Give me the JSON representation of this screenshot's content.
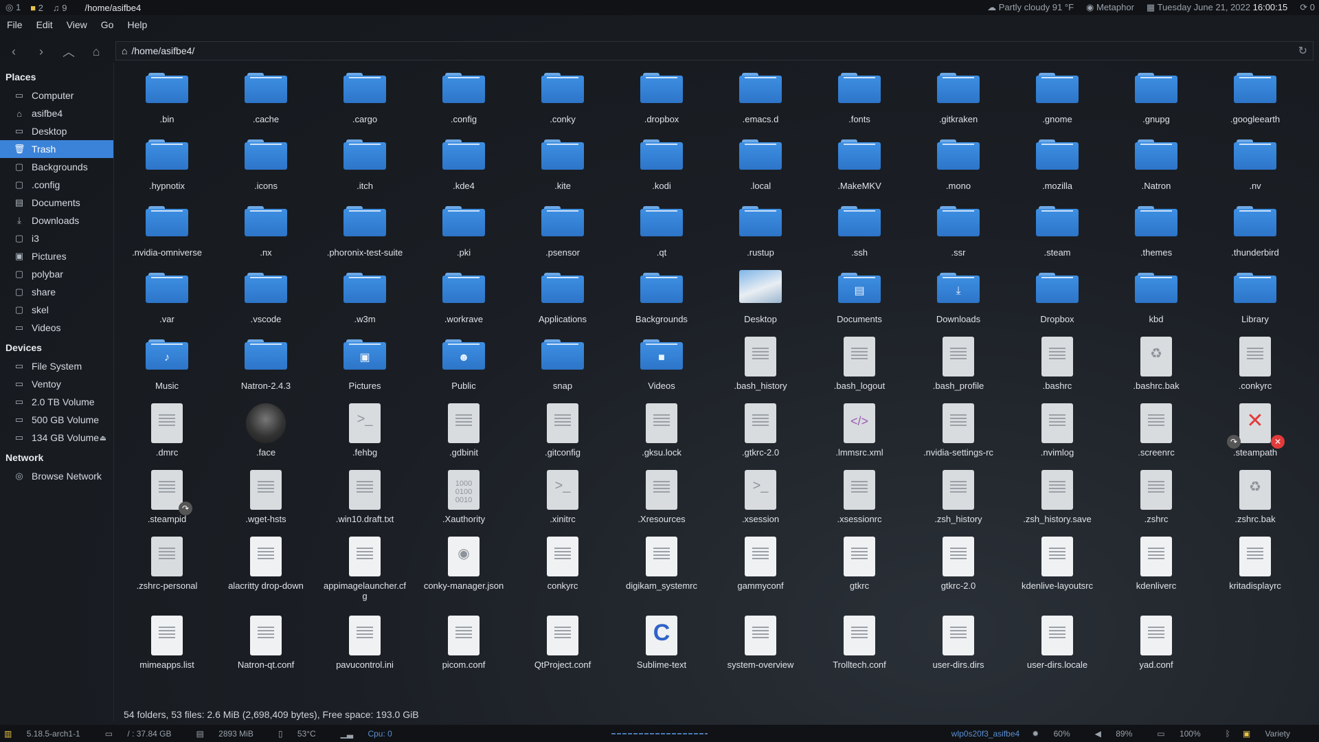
{
  "topbar": {
    "workspaces": [
      "1",
      "2",
      "9"
    ],
    "window_title": "/home/asifbe4",
    "weather": "Partly cloudy 91 °F",
    "theme": "Metaphor",
    "date": "Tuesday  June 21, 2022",
    "time": "16:00:15",
    "updates": "0"
  },
  "menu": [
    "File",
    "Edit",
    "View",
    "Go",
    "Help"
  ],
  "address": "/home/asifbe4/",
  "sidebar": {
    "places_title": "Places",
    "places": [
      {
        "label": "Computer",
        "icon": "computer-icon"
      },
      {
        "label": "asifbe4",
        "icon": "home-icon"
      },
      {
        "label": "Desktop",
        "icon": "desktop-icon"
      },
      {
        "label": "Trash",
        "icon": "trash-icon",
        "active": true
      },
      {
        "label": "Backgrounds",
        "icon": "folder-icon"
      },
      {
        "label": ".config",
        "icon": "folder-icon"
      },
      {
        "label": "Documents",
        "icon": "documents-icon"
      },
      {
        "label": "Downloads",
        "icon": "download-icon"
      },
      {
        "label": "i3",
        "icon": "folder-icon"
      },
      {
        "label": "Pictures",
        "icon": "pictures-icon"
      },
      {
        "label": "polybar",
        "icon": "folder-icon"
      },
      {
        "label": "share",
        "icon": "folder-icon"
      },
      {
        "label": "skel",
        "icon": "folder-icon"
      },
      {
        "label": "Videos",
        "icon": "videos-icon"
      }
    ],
    "devices_title": "Devices",
    "devices": [
      {
        "label": "File System",
        "icon": "drive-icon"
      },
      {
        "label": "Ventoy",
        "icon": "drive-icon"
      },
      {
        "label": "2.0 TB Volume",
        "icon": "drive-icon"
      },
      {
        "label": "500 GB Volume",
        "icon": "drive-icon"
      },
      {
        "label": "134 GB Volume",
        "icon": "drive-icon",
        "eject": true
      }
    ],
    "network_title": "Network",
    "network": [
      {
        "label": "Browse Network",
        "icon": "network-icon"
      }
    ]
  },
  "files": [
    {
      "name": ".bin",
      "kind": "folder"
    },
    {
      "name": ".cache",
      "kind": "folder"
    },
    {
      "name": ".cargo",
      "kind": "folder"
    },
    {
      "name": ".config",
      "kind": "folder"
    },
    {
      "name": ".conky",
      "kind": "folder"
    },
    {
      "name": ".dropbox",
      "kind": "folder"
    },
    {
      "name": ".emacs.d",
      "kind": "folder"
    },
    {
      "name": ".fonts",
      "kind": "folder"
    },
    {
      "name": ".gitkraken",
      "kind": "folder"
    },
    {
      "name": ".gnome",
      "kind": "folder"
    },
    {
      "name": ".gnupg",
      "kind": "folder"
    },
    {
      "name": ".googleearth",
      "kind": "folder"
    },
    {
      "name": ".hypnotix",
      "kind": "folder"
    },
    {
      "name": ".icons",
      "kind": "folder"
    },
    {
      "name": ".itch",
      "kind": "folder"
    },
    {
      "name": ".kde4",
      "kind": "folder"
    },
    {
      "name": ".kite",
      "kind": "folder"
    },
    {
      "name": ".kodi",
      "kind": "folder"
    },
    {
      "name": ".local",
      "kind": "folder"
    },
    {
      "name": ".MakeMKV",
      "kind": "folder"
    },
    {
      "name": ".mono",
      "kind": "folder"
    },
    {
      "name": ".mozilla",
      "kind": "folder"
    },
    {
      "name": ".Natron",
      "kind": "folder"
    },
    {
      "name": ".nv",
      "kind": "folder"
    },
    {
      "name": ".nvidia-omniverse",
      "kind": "folder"
    },
    {
      "name": ".nx",
      "kind": "folder"
    },
    {
      "name": ".phoronix-test-suite",
      "kind": "folder"
    },
    {
      "name": ".pki",
      "kind": "folder"
    },
    {
      "name": ".psensor",
      "kind": "folder"
    },
    {
      "name": ".qt",
      "kind": "folder"
    },
    {
      "name": ".rustup",
      "kind": "folder"
    },
    {
      "name": ".ssh",
      "kind": "folder"
    },
    {
      "name": ".ssr",
      "kind": "folder"
    },
    {
      "name": ".steam",
      "kind": "folder"
    },
    {
      "name": ".themes",
      "kind": "folder"
    },
    {
      "name": ".thunderbird",
      "kind": "folder"
    },
    {
      "name": ".var",
      "kind": "folder"
    },
    {
      "name": ".vscode",
      "kind": "folder"
    },
    {
      "name": ".w3m",
      "kind": "folder"
    },
    {
      "name": ".workrave",
      "kind": "folder"
    },
    {
      "name": "Applications",
      "kind": "folder"
    },
    {
      "name": "Backgrounds",
      "kind": "folder"
    },
    {
      "name": "Desktop",
      "kind": "desktop"
    },
    {
      "name": "Documents",
      "kind": "folder",
      "emblem": "document-emblem-icon"
    },
    {
      "name": "Downloads",
      "kind": "folder",
      "emblem": "download-emblem-icon"
    },
    {
      "name": "Dropbox",
      "kind": "folder"
    },
    {
      "name": "kbd",
      "kind": "folder"
    },
    {
      "name": "Library",
      "kind": "folder"
    },
    {
      "name": "Music",
      "kind": "folder",
      "emblem": "music-emblem-icon"
    },
    {
      "name": "Natron-2.4.3",
      "kind": "folder"
    },
    {
      "name": "Pictures",
      "kind": "folder",
      "emblem": "picture-emblem-icon"
    },
    {
      "name": "Public",
      "kind": "folder",
      "emblem": "people-emblem-icon"
    },
    {
      "name": "snap",
      "kind": "folder"
    },
    {
      "name": "Videos",
      "kind": "folder",
      "emblem": "video-emblem-icon"
    },
    {
      "name": ".bash_history",
      "kind": "text"
    },
    {
      "name": ".bash_logout",
      "kind": "text"
    },
    {
      "name": ".bash_profile",
      "kind": "text"
    },
    {
      "name": ".bashrc",
      "kind": "text"
    },
    {
      "name": ".bashrc.bak",
      "kind": "backup"
    },
    {
      "name": ".conkyrc",
      "kind": "text"
    },
    {
      "name": ".dmrc",
      "kind": "text"
    },
    {
      "name": ".face",
      "kind": "image"
    },
    {
      "name": ".fehbg",
      "kind": "script"
    },
    {
      "name": ".gdbinit",
      "kind": "text"
    },
    {
      "name": ".gitconfig",
      "kind": "text"
    },
    {
      "name": ".gksu.lock",
      "kind": "text"
    },
    {
      "name": ".gtkrc-2.0",
      "kind": "text"
    },
    {
      "name": ".lmmsrc.xml",
      "kind": "xml"
    },
    {
      "name": ".nvidia-settings-rc",
      "kind": "text"
    },
    {
      "name": ".nvimlog",
      "kind": "text"
    },
    {
      "name": ".screenrc",
      "kind": "text"
    },
    {
      "name": ".steampath",
      "kind": "broken"
    },
    {
      "name": ".steampid",
      "kind": "text",
      "link": true
    },
    {
      "name": ".wget-hsts",
      "kind": "text"
    },
    {
      "name": ".win10.draft.txt",
      "kind": "text"
    },
    {
      "name": ".Xauthority",
      "kind": "binary"
    },
    {
      "name": ".xinitrc",
      "kind": "script"
    },
    {
      "name": ".Xresources",
      "kind": "text"
    },
    {
      "name": ".xsession",
      "kind": "script"
    },
    {
      "name": ".xsessionrc",
      "kind": "text"
    },
    {
      "name": ".zsh_history",
      "kind": "text"
    },
    {
      "name": ".zsh_history.save",
      "kind": "text"
    },
    {
      "name": ".zshrc",
      "kind": "text"
    },
    {
      "name": ".zshrc.bak",
      "kind": "backup"
    },
    {
      "name": ".zshrc-personal",
      "kind": "text"
    },
    {
      "name": "alacritty drop-down",
      "kind": "light"
    },
    {
      "name": "appimagelauncher.cfg",
      "kind": "light"
    },
    {
      "name": "conky-manager.json",
      "kind": "json"
    },
    {
      "name": "conkyrc",
      "kind": "light"
    },
    {
      "name": "digikam_systemrc",
      "kind": "light"
    },
    {
      "name": "gammyconf",
      "kind": "light"
    },
    {
      "name": "gtkrc",
      "kind": "light"
    },
    {
      "name": "gtkrc-2.0",
      "kind": "light"
    },
    {
      "name": "kdenlive-layoutsrc",
      "kind": "light"
    },
    {
      "name": "kdenliverc",
      "kind": "light"
    },
    {
      "name": "kritadisplayrc",
      "kind": "light"
    },
    {
      "name": "mimeapps.list",
      "kind": "light"
    },
    {
      "name": "Natron-qt.conf",
      "kind": "light"
    },
    {
      "name": "pavucontrol.ini",
      "kind": "light"
    },
    {
      "name": "picom.conf",
      "kind": "light"
    },
    {
      "name": "QtProject.conf",
      "kind": "light"
    },
    {
      "name": "Sublime-text",
      "kind": "sublime"
    },
    {
      "name": "system-overview",
      "kind": "light"
    },
    {
      "name": "Trolltech.conf",
      "kind": "light"
    },
    {
      "name": "user-dirs.dirs",
      "kind": "light"
    },
    {
      "name": "user-dirs.locale",
      "kind": "light"
    },
    {
      "name": "yad.conf",
      "kind": "light"
    }
  ],
  "status": "54 folders, 53 files: 2.6 MiB (2,698,409 bytes), Free space: 193.0 GiB",
  "bottombar": {
    "kernel": "5.18.5-arch1-1",
    "disk": "/ : 37.84 GB",
    "ram": "2893 MiB",
    "temp": "53°C",
    "cpu": "Cpu: 0",
    "network": "wlp0s20f3_asifbe4",
    "brightness": "60%",
    "volume": "89%",
    "battery": "100%",
    "app": "Variety"
  },
  "colors": {
    "accent": "#3b83d8",
    "folder": "#3d8fe3",
    "bar_bg": "#101215"
  }
}
